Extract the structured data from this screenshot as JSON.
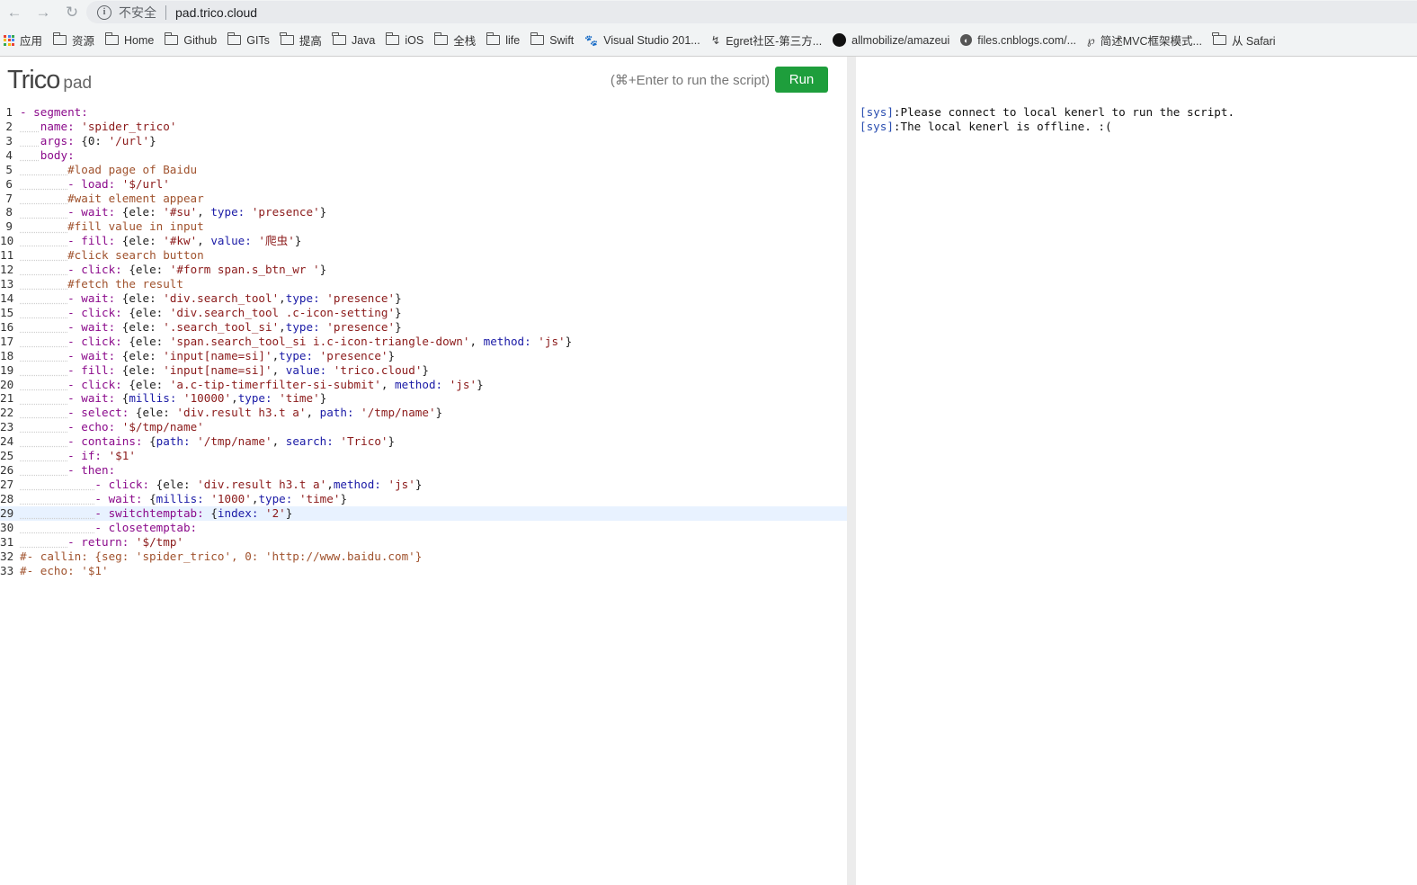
{
  "browser": {
    "security_label": "不安全",
    "url": "pad.trico.cloud",
    "bookmarks": [
      {
        "label": "应用",
        "icon": "apps-icon"
      },
      {
        "label": "资源",
        "icon": "folder-icon"
      },
      {
        "label": "Home",
        "icon": "folder-icon"
      },
      {
        "label": "Github",
        "icon": "folder-icon"
      },
      {
        "label": "GITs",
        "icon": "folder-icon"
      },
      {
        "label": "提高",
        "icon": "folder-icon"
      },
      {
        "label": "Java",
        "icon": "folder-icon"
      },
      {
        "label": "iOS",
        "icon": "folder-icon"
      },
      {
        "label": "全栈",
        "icon": "folder-icon"
      },
      {
        "label": "life",
        "icon": "folder-icon"
      },
      {
        "label": "Swift",
        "icon": "folder-icon"
      },
      {
        "label": "Visual Studio 201...",
        "icon": "paw-icon"
      },
      {
        "label": "Egret社区-第三方...",
        "icon": "egret-icon"
      },
      {
        "label": "allmobilize/amazeui",
        "icon": "github-icon"
      },
      {
        "label": "files.cnblogs.com/...",
        "icon": "globe-icon"
      },
      {
        "label": "简述MVC框架模式...",
        "icon": "cat-icon"
      },
      {
        "label": "从 Safari",
        "icon": "folder-icon"
      }
    ]
  },
  "app": {
    "logo_main": "Trico",
    "logo_sub": "pad",
    "run_hint": "(⌘+Enter to run the script)",
    "run_label": "Run"
  },
  "editor": {
    "active_line": 29,
    "lines": [
      [
        [
          0,
          ""
        ],
        [
          "k",
          "- segment:"
        ]
      ],
      [
        [
          1,
          ""
        ],
        [
          "k",
          "name: "
        ],
        [
          "s",
          "'spider_trico'"
        ]
      ],
      [
        [
          1,
          ""
        ],
        [
          "k",
          "args: "
        ],
        [
          "p",
          "{0: "
        ],
        [
          "s",
          "'/url'"
        ],
        [
          "p",
          "}"
        ]
      ],
      [
        [
          1,
          ""
        ],
        [
          "k",
          "body:"
        ]
      ],
      [
        [
          2,
          ""
        ],
        [
          "c",
          "#load page of Baidu"
        ]
      ],
      [
        [
          2,
          ""
        ],
        [
          "k",
          "- load: "
        ],
        [
          "s",
          "'$/url'"
        ]
      ],
      [
        [
          2,
          ""
        ],
        [
          "c",
          "#wait element appear"
        ]
      ],
      [
        [
          2,
          ""
        ],
        [
          "k",
          "- wait: "
        ],
        [
          "p",
          "{ele: "
        ],
        [
          "s",
          "'#su'"
        ],
        [
          "p",
          ", "
        ],
        [
          "w",
          "type: "
        ],
        [
          "s",
          "'presence'"
        ],
        [
          "p",
          "}"
        ]
      ],
      [
        [
          2,
          ""
        ],
        [
          "c",
          "#fill value in input"
        ]
      ],
      [
        [
          2,
          ""
        ],
        [
          "k",
          "- fill: "
        ],
        [
          "p",
          "{ele: "
        ],
        [
          "s",
          "'#kw'"
        ],
        [
          "p",
          ", "
        ],
        [
          "w",
          "value: "
        ],
        [
          "s",
          "'爬虫'"
        ],
        [
          "p",
          "}"
        ]
      ],
      [
        [
          2,
          ""
        ],
        [
          "c",
          "#click search button"
        ]
      ],
      [
        [
          2,
          ""
        ],
        [
          "k",
          "- click: "
        ],
        [
          "p",
          "{ele: "
        ],
        [
          "s",
          "'#form span.s_btn_wr '"
        ],
        [
          "p",
          "}"
        ]
      ],
      [
        [
          2,
          ""
        ],
        [
          "c",
          "#fetch the result"
        ]
      ],
      [
        [
          2,
          ""
        ],
        [
          "k",
          "- wait: "
        ],
        [
          "p",
          "{ele: "
        ],
        [
          "s",
          "'div.search_tool'"
        ],
        [
          "p",
          ","
        ],
        [
          "w",
          "type: "
        ],
        [
          "s",
          "'presence'"
        ],
        [
          "p",
          "}"
        ]
      ],
      [
        [
          2,
          ""
        ],
        [
          "k",
          "- click: "
        ],
        [
          "p",
          "{ele: "
        ],
        [
          "s",
          "'div.search_tool .c-icon-setting'"
        ],
        [
          "p",
          "}"
        ]
      ],
      [
        [
          2,
          ""
        ],
        [
          "k",
          "- wait: "
        ],
        [
          "p",
          "{ele: "
        ],
        [
          "s",
          "'.search_tool_si'"
        ],
        [
          "p",
          ","
        ],
        [
          "w",
          "type: "
        ],
        [
          "s",
          "'presence'"
        ],
        [
          "p",
          "}"
        ]
      ],
      [
        [
          2,
          ""
        ],
        [
          "k",
          "- click: "
        ],
        [
          "p",
          "{ele: "
        ],
        [
          "s",
          "'span.search_tool_si i.c-icon-triangle-down'"
        ],
        [
          "p",
          ", "
        ],
        [
          "w",
          "method: "
        ],
        [
          "s",
          "'js'"
        ],
        [
          "p",
          "}"
        ]
      ],
      [
        [
          2,
          ""
        ],
        [
          "k",
          "- wait: "
        ],
        [
          "p",
          "{ele: "
        ],
        [
          "s",
          "'input[name=si]'"
        ],
        [
          "p",
          ","
        ],
        [
          "w",
          "type: "
        ],
        [
          "s",
          "'presence'"
        ],
        [
          "p",
          "}"
        ]
      ],
      [
        [
          2,
          ""
        ],
        [
          "k",
          "- fill: "
        ],
        [
          "p",
          "{ele: "
        ],
        [
          "s",
          "'input[name=si]'"
        ],
        [
          "p",
          ", "
        ],
        [
          "w",
          "value: "
        ],
        [
          "s",
          "'trico.cloud'"
        ],
        [
          "p",
          "}"
        ]
      ],
      [
        [
          2,
          ""
        ],
        [
          "k",
          "- click: "
        ],
        [
          "p",
          "{ele: "
        ],
        [
          "s",
          "'a.c-tip-timerfilter-si-submit'"
        ],
        [
          "p",
          ", "
        ],
        [
          "w",
          "method: "
        ],
        [
          "s",
          "'js'"
        ],
        [
          "p",
          "}"
        ]
      ],
      [
        [
          2,
          ""
        ],
        [
          "k",
          "- wait: "
        ],
        [
          "p",
          "{"
        ],
        [
          "w",
          "millis: "
        ],
        [
          "s",
          "'10000'"
        ],
        [
          "p",
          ","
        ],
        [
          "w",
          "type: "
        ],
        [
          "s",
          "'time'"
        ],
        [
          "p",
          "}"
        ]
      ],
      [
        [
          2,
          ""
        ],
        [
          "k",
          "- select: "
        ],
        [
          "p",
          "{ele: "
        ],
        [
          "s",
          "'div.result h3.t a'"
        ],
        [
          "p",
          ", "
        ],
        [
          "w",
          "path: "
        ],
        [
          "s",
          "'/tmp/name'"
        ],
        [
          "p",
          "}"
        ]
      ],
      [
        [
          2,
          ""
        ],
        [
          "k",
          "- echo: "
        ],
        [
          "s",
          "'$/tmp/name'"
        ]
      ],
      [
        [
          2,
          ""
        ],
        [
          "k",
          "- contains: "
        ],
        [
          "p",
          "{"
        ],
        [
          "w",
          "path: "
        ],
        [
          "s",
          "'/tmp/name'"
        ],
        [
          "p",
          ", "
        ],
        [
          "w",
          "search: "
        ],
        [
          "s",
          "'Trico'"
        ],
        [
          "p",
          "}"
        ]
      ],
      [
        [
          2,
          ""
        ],
        [
          "k",
          "- if: "
        ],
        [
          "s",
          "'$1'"
        ]
      ],
      [
        [
          2,
          ""
        ],
        [
          "k",
          "- then:"
        ]
      ],
      [
        [
          3,
          ""
        ],
        [
          "k",
          "- click: "
        ],
        [
          "p",
          "{ele: "
        ],
        [
          "s",
          "'div.result h3.t a'"
        ],
        [
          "p",
          ","
        ],
        [
          "w",
          "method: "
        ],
        [
          "s",
          "'js'"
        ],
        [
          "p",
          "}"
        ]
      ],
      [
        [
          3,
          ""
        ],
        [
          "k",
          "- wait: "
        ],
        [
          "p",
          "{"
        ],
        [
          "w",
          "millis: "
        ],
        [
          "s",
          "'1000'"
        ],
        [
          "p",
          ","
        ],
        [
          "w",
          "type: "
        ],
        [
          "s",
          "'time'"
        ],
        [
          "p",
          "}"
        ]
      ],
      [
        [
          3,
          ""
        ],
        [
          "k",
          "- switchtemptab: "
        ],
        [
          "p",
          "{"
        ],
        [
          "w",
          "index: "
        ],
        [
          "s",
          "'2'"
        ],
        [
          "p",
          "}"
        ]
      ],
      [
        [
          3,
          ""
        ],
        [
          "k",
          "- closetemptab:"
        ]
      ],
      [
        [
          2,
          ""
        ],
        [
          "k",
          "- return: "
        ],
        [
          "s",
          "'$/tmp'"
        ]
      ],
      [
        [
          0,
          ""
        ],
        [
          "c",
          "#- callin: {seg: 'spider_trico', 0: 'http://www.baidu.com'}"
        ]
      ],
      [
        [
          0,
          ""
        ],
        [
          "c",
          "#- echo: '$1'"
        ]
      ]
    ]
  },
  "console": {
    "lines": [
      {
        "tag": "[sys]",
        "msg": ":Please connect to local kenerl to run the script."
      },
      {
        "tag": "[sys]",
        "msg": ":The local kenerl is offline. :("
      }
    ]
  },
  "colors": {
    "run_button": "#1e9e3c",
    "active_line": "#e8f2ff"
  }
}
